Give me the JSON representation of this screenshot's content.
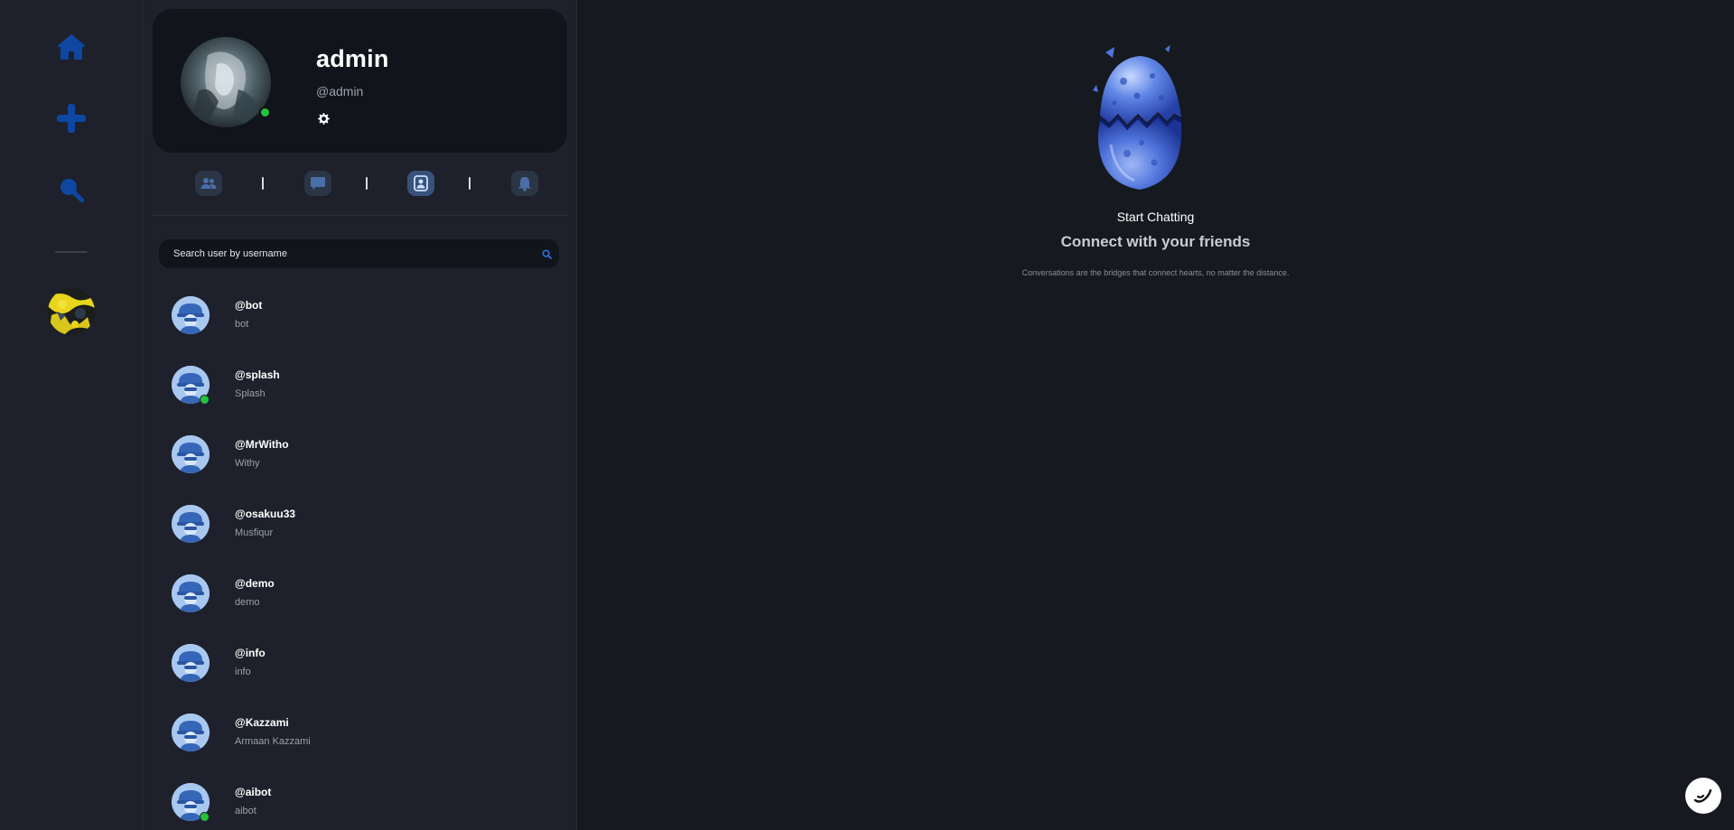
{
  "profile": {
    "name": "admin",
    "handle": "@admin",
    "online": true
  },
  "rail": {
    "items": [
      "home-icon",
      "plus-icon",
      "search-icon"
    ]
  },
  "tabs": {
    "items": [
      "friends-icon",
      "chat-icon",
      "contact-icon",
      "bell-icon"
    ],
    "active_index": 2
  },
  "search": {
    "placeholder": "Search user by username"
  },
  "users": [
    {
      "handle": "@bot",
      "name": "bot",
      "online": false
    },
    {
      "handle": "@splash",
      "name": "Splash",
      "online": true
    },
    {
      "handle": "@MrWitho",
      "name": "Withy",
      "online": false
    },
    {
      "handle": "@osakuu33",
      "name": "Musfiqur",
      "online": false
    },
    {
      "handle": "@demo",
      "name": "demo",
      "online": false
    },
    {
      "handle": "@info",
      "name": "info",
      "online": false
    },
    {
      "handle": "@Kazzami",
      "name": "Armaan Kazzami",
      "online": false
    },
    {
      "handle": "@aibot",
      "name": "aibot",
      "online": true
    }
  ],
  "main": {
    "start_label": "Start Chatting",
    "title": "Connect with your friends",
    "tagline": "Conversations are the bridges that connect hearts, no matter the distance."
  },
  "colors": {
    "accent": "#0d47a1",
    "online": "#22c23d",
    "panel": "#1e212b",
    "card": "#11141a",
    "background": "#16191f"
  }
}
